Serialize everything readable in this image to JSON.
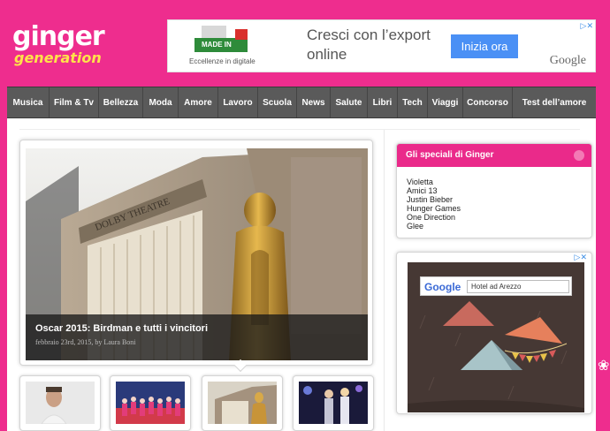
{
  "brand": {
    "line1": "ginger",
    "line2": "generation"
  },
  "top_ad": {
    "badge_text": "MADE IN ITALY",
    "badge_sub": "Eccellenze in digitale",
    "message": "Cresci con l’export online",
    "cta_label": "Inizia ora",
    "google_label": "Google"
  },
  "nav": {
    "items": [
      {
        "label": "Musica"
      },
      {
        "label": "Film & Tv"
      },
      {
        "label": "Bellezza"
      },
      {
        "label": "Moda"
      },
      {
        "label": "Amore"
      },
      {
        "label": "Lavoro"
      },
      {
        "label": "Scuola"
      },
      {
        "label": "News"
      },
      {
        "label": "Salute"
      },
      {
        "label": "Libri"
      },
      {
        "label": "Tech"
      },
      {
        "label": "Viaggi"
      },
      {
        "label": "Concorso"
      },
      {
        "label": "Test dell’amore"
      }
    ]
  },
  "featured": {
    "title": "Oscar 2015: Birdman e tutti i vincitori",
    "meta": "febbraio 23rd, 2015, by Laura Boni"
  },
  "specials": {
    "title": "Gli speciali di Ginger",
    "items": [
      {
        "label": "Violetta"
      },
      {
        "label": "Amici 13"
      },
      {
        "label": "Justin Bieber"
      },
      {
        "label": "Hunger Games"
      },
      {
        "label": "One Direction"
      },
      {
        "label": "Glee"
      }
    ]
  },
  "side_ad": {
    "google_label": "Google",
    "search_query": "Hotel ad Arezzo"
  },
  "colors": {
    "brand_pink": "#ee2d8e",
    "nav_gray": "#5a5a5a",
    "header_pink": "#ea2a8a",
    "cta_blue": "#4a90f5"
  }
}
